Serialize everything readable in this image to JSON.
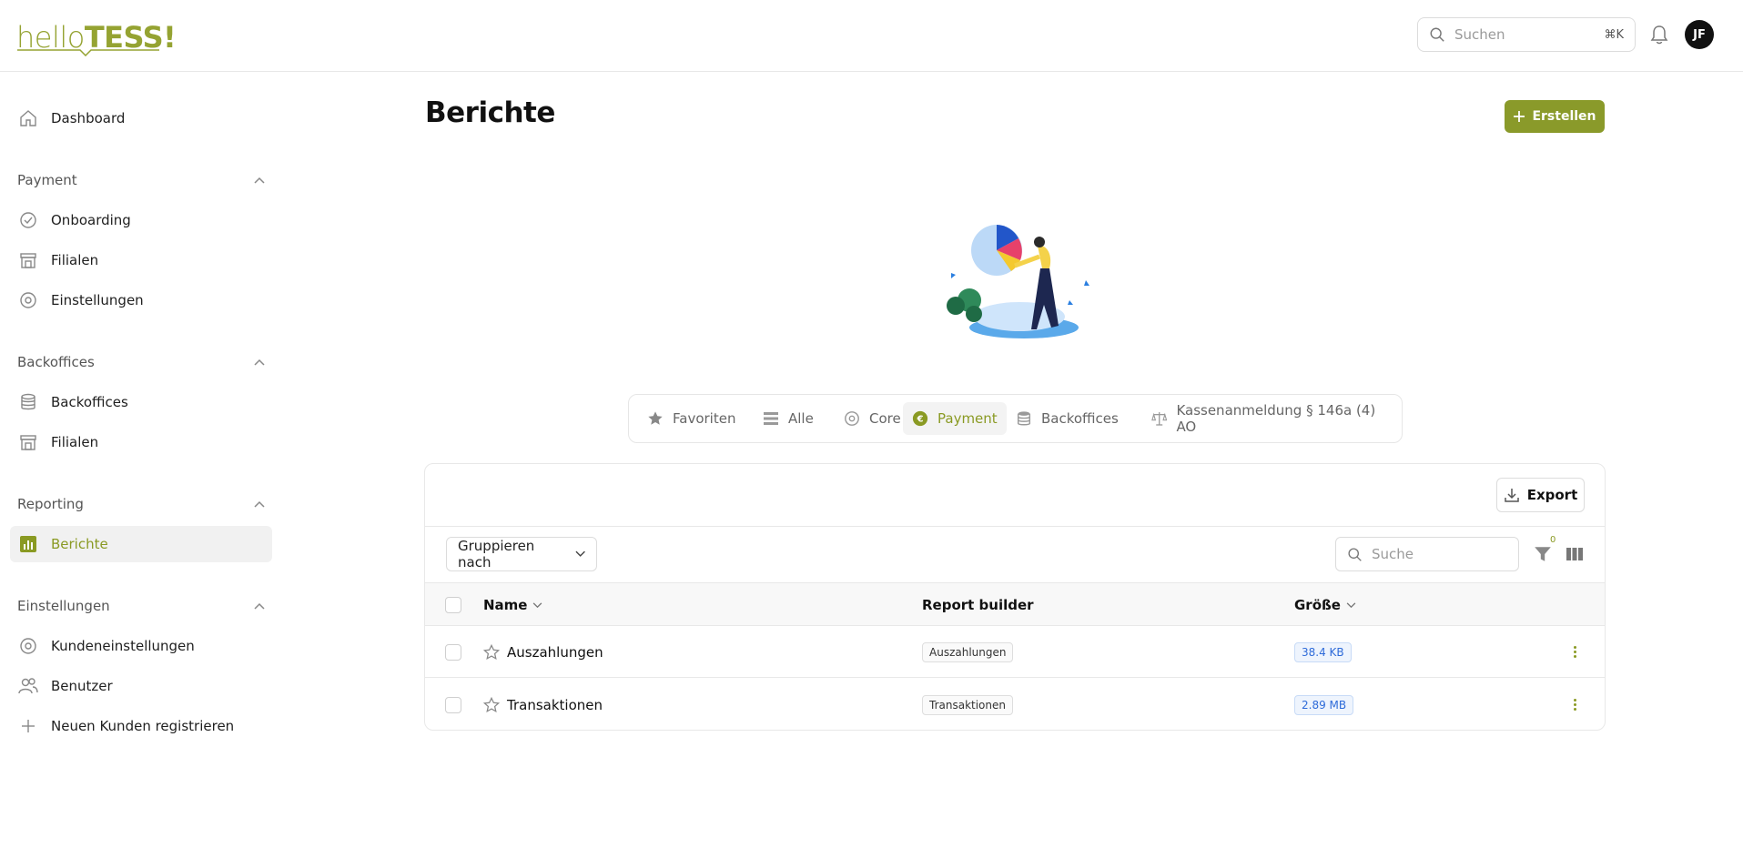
{
  "header": {
    "logo_thin": "hello",
    "logo_bold": "TESS!",
    "search_placeholder": "Suchen",
    "search_shortcut": "⌘K",
    "avatar_initials": "JF"
  },
  "sidebar": {
    "dashboard": "Dashboard",
    "sections": [
      {
        "title": "Payment",
        "items": [
          "Onboarding",
          "Filialen",
          "Einstellungen"
        ]
      },
      {
        "title": "Backoffices",
        "items": [
          "Backoffices",
          "Filialen"
        ]
      },
      {
        "title": "Reporting",
        "items": [
          "Berichte"
        ]
      },
      {
        "title": "Einstellungen",
        "items": [
          "Kundeneinstellungen",
          "Benutzer",
          "Neuen Kunden registrieren"
        ]
      }
    ],
    "active_item": "Berichte"
  },
  "page": {
    "title": "Berichte",
    "create_label": "Erstellen"
  },
  "tabs": [
    {
      "label": "Favoriten",
      "icon": "star-icon"
    },
    {
      "label": "Alle",
      "icon": "list-icon"
    },
    {
      "label": "Core",
      "icon": "cog-icon"
    },
    {
      "label": "Payment",
      "icon": "euro-icon",
      "active": true
    },
    {
      "label": "Backoffices",
      "icon": "database-icon"
    },
    {
      "label": "Kassenanmeldung § 146a (4) AO",
      "icon": "scale-icon"
    }
  ],
  "table": {
    "export_label": "Export",
    "group_by_label": "Gruppieren nach",
    "search_placeholder": "Suche",
    "filter_count": "0",
    "columns": {
      "name": "Name",
      "builder": "Report builder",
      "size": "Größe"
    },
    "rows": [
      {
        "name": "Auszahlungen",
        "builder": "Auszahlungen",
        "size": "38.4 KB"
      },
      {
        "name": "Transaktionen",
        "builder": "Transaktionen",
        "size": "2.89 MB"
      }
    ]
  },
  "colors": {
    "accent": "#8a9a2a",
    "brand": "#95a332",
    "size_tag": "#2e6bd9"
  }
}
